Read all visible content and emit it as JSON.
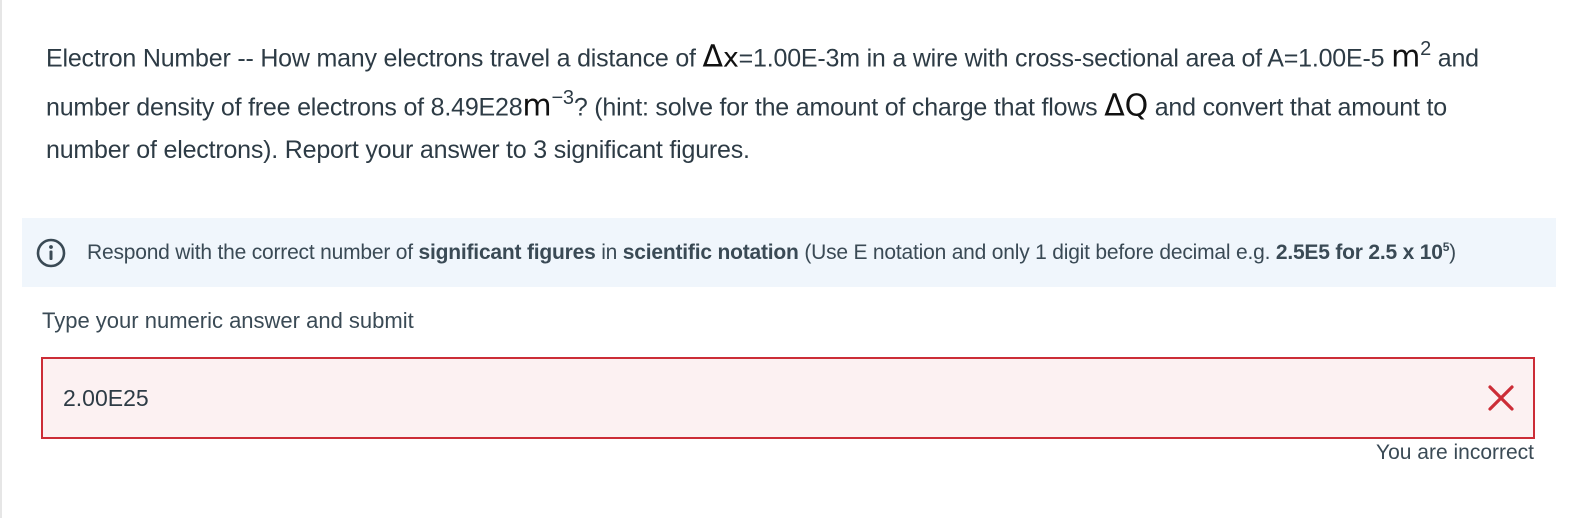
{
  "question": {
    "intro": "Electron Number -- How many electrons travel a distance of ",
    "delta_symbol": "Δ",
    "x_var": "x",
    "dist_value": "=1.00E-3m in a wire with cross-sectional area of A=1.00E-5 ",
    "unit_m": "m",
    "exp_2": "2",
    "and_text": " and number density of free electrons of 8.49E28",
    "unit_m2": "m",
    "exp_neg3": "−3",
    "hint_text": "? (hint: solve for the amount of charge that flows ",
    "delta_q_symbol": "Δ",
    "q_var": "Q",
    "tail": " and convert that amount to number of electrons). Report your answer to 3 significant figures."
  },
  "info": {
    "p1": "Respond with the correct number of ",
    "b1": "significant figures",
    "p2": " in ",
    "b2": "scientific notation",
    "p3": " (Use E notation and only 1 digit before decimal e.g. ",
    "b3": "2.5E5 for 2.5 x 10",
    "b3_sup": "5",
    "p4": ")"
  },
  "answer": {
    "label": "Type your numeric answer and submit",
    "value": "2.00E25",
    "status": "You are incorrect"
  },
  "colors": {
    "error_border": "#cc2d37",
    "error_bg": "#fcf1f2",
    "info_bg": "#f0f6fc"
  },
  "icons": {
    "info": "info-circle-icon",
    "incorrect": "x-icon"
  }
}
